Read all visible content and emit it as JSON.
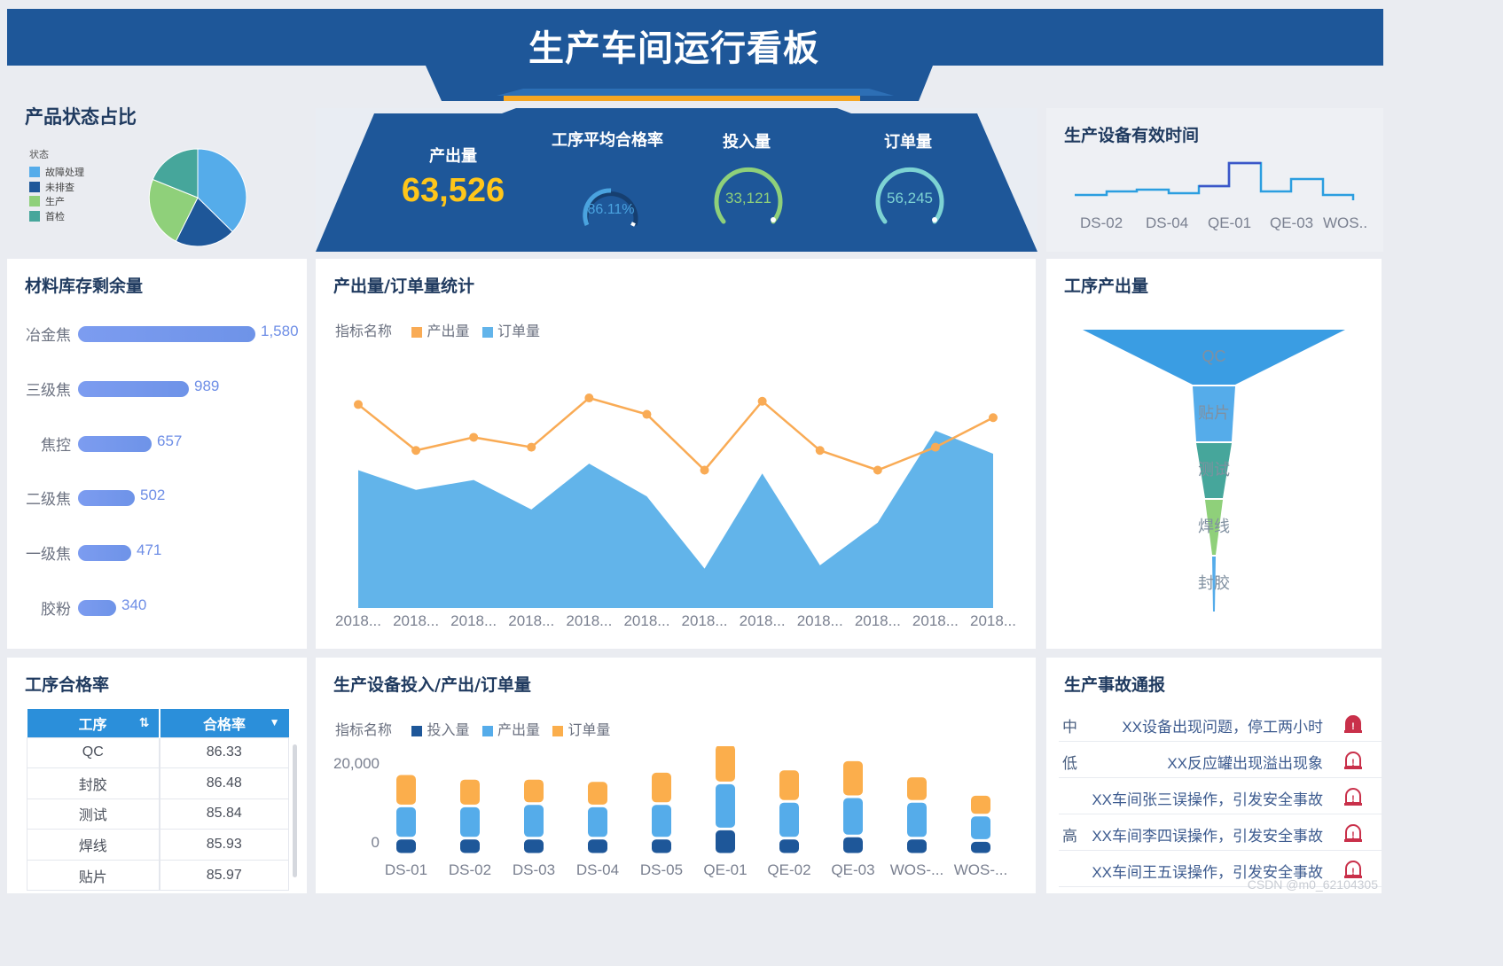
{
  "header": {
    "title": "生产车间运行看板"
  },
  "colors": {
    "header_blue": "#1e5799",
    "accent_orange": "#f5a623",
    "kpi_yellow": "#ffc61a",
    "series_blue": "#55acea",
    "series_navy": "#1e5799",
    "series_orange": "#fbae4c"
  },
  "product_status": {
    "title": "产品状态占比",
    "legend_title": "状态",
    "items": [
      {
        "label": "故障处理",
        "color": "#55acea"
      },
      {
        "label": "未排查",
        "color": "#1e5799"
      },
      {
        "label": "生产",
        "color": "#8fd07a"
      },
      {
        "label": "首检",
        "color": "#46a69b"
      }
    ]
  },
  "kpis": [
    {
      "label": "产出量",
      "value": "63,526"
    },
    {
      "label": "工序平均合格率",
      "value": "86.11%"
    },
    {
      "label": "投入量",
      "value": "33,121"
    },
    {
      "label": "订单量",
      "value": "56,245"
    }
  ],
  "equipment_time": {
    "title": "生产设备有效时间",
    "x_labels": [
      "DS-02",
      "DS-04",
      "QE-01",
      "QE-03",
      "WOS.."
    ]
  },
  "inventory": {
    "title": "材料库存剩余量",
    "items": [
      {
        "label": "冶金焦",
        "value": 1580,
        "display": "1,580"
      },
      {
        "label": "三级焦",
        "value": 989,
        "display": "989"
      },
      {
        "label": "焦控",
        "value": 657,
        "display": "657"
      },
      {
        "label": "二级焦",
        "value": 502,
        "display": "502"
      },
      {
        "label": "一级焦",
        "value": 471,
        "display": "471"
      },
      {
        "label": "胶粉",
        "value": 340,
        "display": "340"
      }
    ]
  },
  "output_order": {
    "title": "产出量/订单量统计",
    "legend_title": "指标名称",
    "chart_data": {
      "type": "line",
      "categories": [
        "2018...",
        "2018...",
        "2018...",
        "2018...",
        "2018...",
        "2018...",
        "2018...",
        "2018...",
        "2018...",
        "2018...",
        "2018...",
        "2018..."
      ],
      "series": [
        {
          "name": "产出量",
          "type": "line",
          "color": "#f9ab55",
          "values": [
            5900,
            5200,
            5400,
            5250,
            6000,
            5750,
            4900,
            5950,
            5200,
            4900,
            5250,
            5700
          ]
        },
        {
          "name": "订单量",
          "type": "area",
          "color": "#62b4ea",
          "values": [
            4900,
            4600,
            4750,
            4300,
            5000,
            4500,
            3400,
            4850,
            3450,
            4100,
            5500,
            5150
          ]
        }
      ],
      "ylim": [
        2800,
        6500
      ]
    }
  },
  "process_output": {
    "title": "工序产出量",
    "chart_data": {
      "type": "funnel",
      "categories": [
        "QC",
        "贴片",
        "测试",
        "焊线",
        "封胶"
      ],
      "values": [
        100,
        14,
        12,
        6,
        1
      ]
    }
  },
  "pass_rate": {
    "title": "工序合格率",
    "columns": [
      "工序",
      "合格率"
    ],
    "rows": [
      {
        "process": "QC",
        "rate": "86.33"
      },
      {
        "process": "封胶",
        "rate": "86.48"
      },
      {
        "process": "测试",
        "rate": "85.84"
      },
      {
        "process": "焊线",
        "rate": "85.93"
      },
      {
        "process": "贴片",
        "rate": "85.97"
      }
    ]
  },
  "equipment_io": {
    "title": "生产设备投入/产出/订单量",
    "legend_title": "指标名称",
    "y_ticks": [
      "20,000",
      "0"
    ],
    "chart_data": {
      "type": "bar",
      "stacked": true,
      "categories": [
        "DS-01",
        "DS-02",
        "DS-03",
        "DS-04",
        "DS-05",
        "QE-01",
        "QE-02",
        "QE-03",
        "WOS-...",
        "WOS-..."
      ],
      "series": [
        {
          "name": "投入量",
          "color": "#1e5799",
          "values": [
            3500,
            3500,
            3500,
            3500,
            3500,
            5500,
            3500,
            4000,
            3500,
            3000
          ]
        },
        {
          "name": "产出量",
          "color": "#55acea",
          "values": [
            7000,
            7000,
            7500,
            7000,
            7500,
            10000,
            8000,
            8500,
            8000,
            5500
          ]
        },
        {
          "name": "订单量",
          "color": "#fbae4c",
          "values": [
            7000,
            6000,
            5500,
            5500,
            7000,
            8500,
            7000,
            8000,
            5500,
            4500
          ]
        }
      ],
      "ylim": [
        0,
        20000
      ]
    }
  },
  "accidents": {
    "title": "生产事故通报",
    "rows": [
      {
        "level": "中",
        "text": "XX设备出现问题，停工两小时",
        "icon": "alarm-icon"
      },
      {
        "level": "低",
        "text": "XX反应罐出现溢出现象",
        "icon": "alarm-icon"
      },
      {
        "level": "",
        "text": "XX车间张三误操作，引发安全事故",
        "icon": "alarm-icon"
      },
      {
        "level": "高",
        "text": "XX车间李四误操作，引发安全事故",
        "icon": "alarm-icon"
      },
      {
        "level": "",
        "text": "XX车间王五误操作，引发安全事故",
        "icon": "alarm-icon"
      }
    ]
  },
  "watermark": "CSDN @m0_62104305"
}
